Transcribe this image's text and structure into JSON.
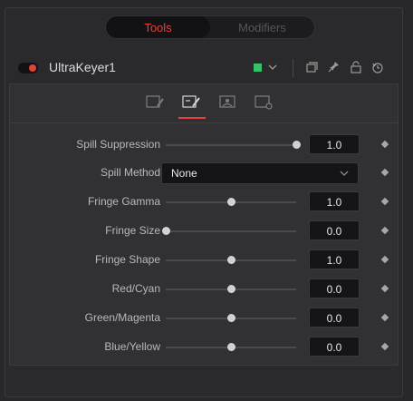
{
  "tabs": [
    {
      "label": "Tools",
      "active": true
    },
    {
      "label": "Modifiers",
      "active": false
    }
  ],
  "tool": {
    "name": "UltraKeyer1",
    "color_swatch": "#38c06a"
  },
  "header_icons": [
    "chevron-down-icon",
    "copy-icon",
    "pin-icon",
    "lock-icon",
    "reset-icon"
  ],
  "subtabs": [
    {
      "icon": "keyer-controls-icon",
      "active": false
    },
    {
      "icon": "spill-icon",
      "active": true
    },
    {
      "icon": "image-icon",
      "active": false
    },
    {
      "icon": "settings-icon",
      "active": false
    }
  ],
  "controls": [
    {
      "label": "Spill Suppression",
      "type": "slider",
      "value": "1.0",
      "fraction": 1.0
    },
    {
      "label": "Spill Method",
      "type": "dropdown",
      "value": "None"
    },
    {
      "label": "Fringe Gamma",
      "type": "slider",
      "value": "1.0",
      "fraction": 0.5
    },
    {
      "label": "Fringe Size",
      "type": "slider",
      "value": "0.0",
      "fraction": 0.0
    },
    {
      "label": "Fringe Shape",
      "type": "slider",
      "value": "1.0",
      "fraction": 0.5
    },
    {
      "label": "Red/Cyan",
      "type": "slider",
      "value": "0.0",
      "fraction": 0.5
    },
    {
      "label": "Green/Magenta",
      "type": "slider",
      "value": "0.0",
      "fraction": 0.5
    },
    {
      "label": "Blue/Yellow",
      "type": "slider",
      "value": "0.0",
      "fraction": 0.5
    }
  ],
  "colors": {
    "accent": "#e6403a",
    "background": "#28282b"
  }
}
